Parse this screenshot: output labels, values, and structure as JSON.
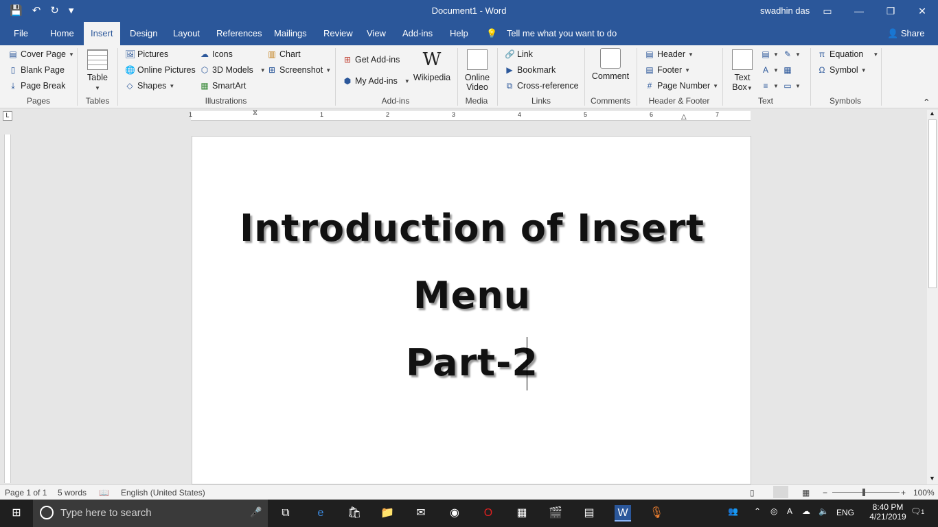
{
  "window": {
    "title": "Document1  -  Word",
    "user": "swadhin das",
    "controls": [
      "—",
      "❐",
      "✕"
    ]
  },
  "quick_access": [
    "💾",
    "↶",
    "↻",
    "▾"
  ],
  "tabs": [
    "File",
    "Home",
    "Insert",
    "Design",
    "Layout",
    "References",
    "Mailings",
    "Review",
    "View",
    "Add-ins",
    "Help"
  ],
  "active_tab": "Insert",
  "tell_me": "Tell me what you want to do",
  "share": "Share",
  "groups": {
    "pages": {
      "label": "Pages",
      "items": [
        "Cover Page",
        "Blank Page",
        "Page Break"
      ]
    },
    "tables": {
      "label": "Tables",
      "table": "Table"
    },
    "illustrations": {
      "label": "Illustrations",
      "pictures": "Pictures",
      "online_pictures": "Online Pictures",
      "shapes": "Shapes",
      "icons": "Icons",
      "models": "3D Models",
      "smartart": "SmartArt",
      "chart": "Chart",
      "screenshot": "Screenshot"
    },
    "addins": {
      "label": "Add-ins",
      "get": "Get Add-ins",
      "my": "My Add-ins",
      "wikipedia": "Wikipedia",
      "wiki_glyph": "W"
    },
    "media": {
      "label": "Media",
      "line1": "Online",
      "line2": "Video"
    },
    "links": {
      "label": "Links",
      "link": "Link",
      "bookmark": "Bookmark",
      "cross": "Cross-reference"
    },
    "comments": {
      "label": "Comments",
      "comment": "Comment"
    },
    "header_footer": {
      "label": "Header & Footer",
      "header": "Header",
      "footer": "Footer",
      "page_number": "Page Number"
    },
    "text": {
      "label": "Text",
      "line1": "Text",
      "line2": "Box"
    },
    "symbols": {
      "label": "Symbols",
      "equation": "Equation",
      "symbol": "Symbol"
    }
  },
  "ruler_marks": [
    "1",
    "1",
    "2",
    "3",
    "4",
    "5",
    "6",
    "7"
  ],
  "document": {
    "lines": [
      "Introduction of Insert",
      "Menu",
      "Part-2"
    ]
  },
  "status": {
    "page": "Page 1 of 1",
    "words": "5 words",
    "language": "English (United States)",
    "zoom": "100%"
  },
  "taskbar": {
    "search_placeholder": "Type here to search",
    "lang": "ENG",
    "time": "8:40 PM",
    "date": "4/21/2019",
    "notif": "1"
  }
}
